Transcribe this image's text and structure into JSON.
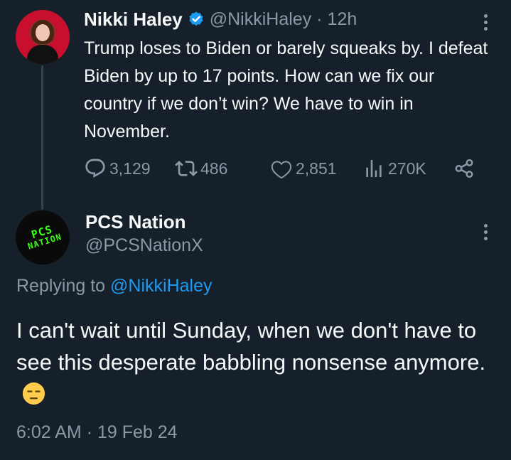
{
  "parent_tweet": {
    "author_name": "Nikki Haley",
    "handle": "@NikkiHaley",
    "separator": "·",
    "time": "12h",
    "text": "Trump loses to Biden or barely squeaks by. I defeat Biden by up to 17 points. How can we fix our country if we don’t win? We have to win in November.",
    "stats": {
      "replies": "3,129",
      "reposts": "486",
      "likes": "2,851",
      "views": "270K"
    },
    "verified_color": "#1d9bf0"
  },
  "reply_tweet": {
    "avatar_logo_lines": [
      "PCS",
      "NATION"
    ],
    "author_name": "PCS Nation",
    "handle": "@PCSNationX",
    "replying_prefix": "Replying to ",
    "replying_mention": "@NikkiHaley",
    "text": "I can't wait until Sunday, when we don't have to see this desperate babbling nonsense anymore.",
    "emoji": "expressionless-face",
    "time": "6:02 AM",
    "separator": "·",
    "date": "19 Feb 24"
  },
  "icons": {
    "reply": "reply-icon",
    "repost": "repost-icon",
    "like": "heart-icon",
    "views": "views-icon",
    "share": "share-icon",
    "more": "more-icon"
  },
  "colors": {
    "background": "#15202b",
    "primary_text": "#f7f9f9",
    "secondary_text": "#8b98a5",
    "link": "#1d9bf0",
    "logo_green": "#39ff14"
  }
}
